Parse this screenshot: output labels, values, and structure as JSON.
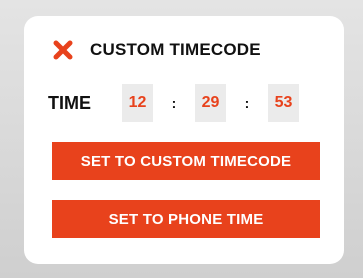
{
  "dialog": {
    "title": "CUSTOM TIMECODE",
    "close_icon": "close-x-icon"
  },
  "time": {
    "label": "TIME",
    "hours": "12",
    "minutes": "29",
    "seconds": "53",
    "separator": ":"
  },
  "buttons": {
    "set_custom": "SET TO CUSTOM TIMECODE",
    "set_phone": "SET TO PHONE TIME"
  },
  "colors": {
    "accent": "#e8421c",
    "panel": "#ffffff",
    "field_bg": "#ebebeb"
  }
}
